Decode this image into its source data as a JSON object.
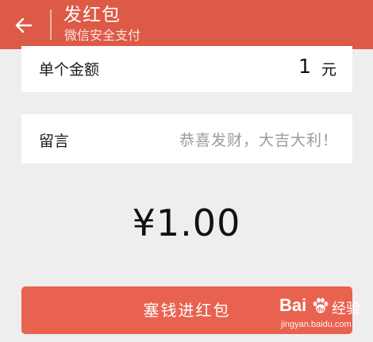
{
  "header": {
    "back_icon": "arrow-left-icon",
    "title": "发红包",
    "subtitle": "微信安全支付"
  },
  "amount_card": {
    "label": "单个金额",
    "value": "1",
    "unit": "元"
  },
  "message_card": {
    "label": "留言",
    "placeholder": "恭喜发财，大吉大利！"
  },
  "total": {
    "display": "¥1.00"
  },
  "submit": {
    "label": "塞钱进红包"
  },
  "watermark": {
    "logo_text": "Bai",
    "logo_icon": "paw-icon",
    "logo_suffix": "经验",
    "url": "jingyan.baidu.com"
  },
  "colors": {
    "header_bg": "#dc5a46",
    "button_bg": "#e8624f",
    "page_bg": "#eeeeee"
  }
}
